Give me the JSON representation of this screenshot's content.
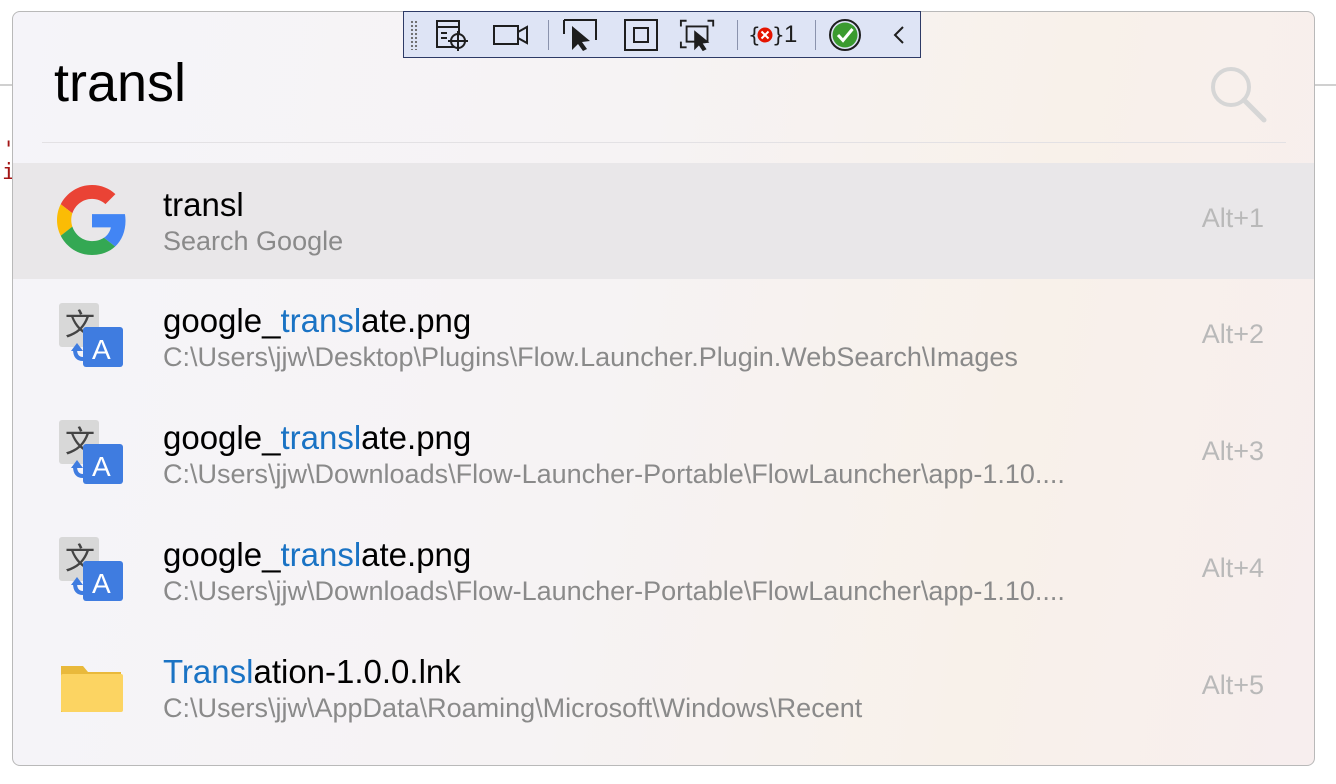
{
  "search": {
    "query": "transl"
  },
  "results": [
    {
      "icon": "google-g-icon",
      "title_parts": [
        {
          "text": "transl",
          "hl": false
        }
      ],
      "subtitle": "Search Google",
      "hotkey": "Alt+1",
      "selected": true
    },
    {
      "icon": "translate-icon",
      "title_parts": [
        {
          "text": "google_",
          "hl": false
        },
        {
          "text": "transl",
          "hl": true
        },
        {
          "text": "ate.png",
          "hl": false
        }
      ],
      "subtitle": "C:\\Users\\jjw\\Desktop\\Plugins\\Flow.Launcher.Plugin.WebSearch\\Images",
      "hotkey": "Alt+2",
      "selected": false
    },
    {
      "icon": "translate-icon",
      "title_parts": [
        {
          "text": "google_",
          "hl": false
        },
        {
          "text": "transl",
          "hl": true
        },
        {
          "text": "ate.png",
          "hl": false
        }
      ],
      "subtitle": "C:\\Users\\jjw\\Downloads\\Flow-Launcher-Portable\\FlowLauncher\\app-1.10....",
      "hotkey": "Alt+3",
      "selected": false
    },
    {
      "icon": "translate-icon",
      "title_parts": [
        {
          "text": "google_",
          "hl": false
        },
        {
          "text": "transl",
          "hl": true
        },
        {
          "text": "ate.png",
          "hl": false
        }
      ],
      "subtitle": "C:\\Users\\jjw\\Downloads\\Flow-Launcher-Portable\\FlowLauncher\\app-1.10....",
      "hotkey": "Alt+4",
      "selected": false
    },
    {
      "icon": "folder-icon",
      "title_parts": [
        {
          "text": "Transl",
          "hl": true
        },
        {
          "text": "ation-1.0.0.lnk",
          "hl": false
        }
      ],
      "subtitle": "C:\\Users\\jjw\\AppData\\Roaming\\Microsoft\\Windows\\Recent",
      "hotkey": "Alt+5",
      "selected": false
    }
  ],
  "debug_toolbar": {
    "error_count": "1"
  },
  "colors": {
    "highlight": "#1a73c4",
    "selected_row": "#e9e7e9",
    "toolbar_bg": "#dee4f5"
  }
}
